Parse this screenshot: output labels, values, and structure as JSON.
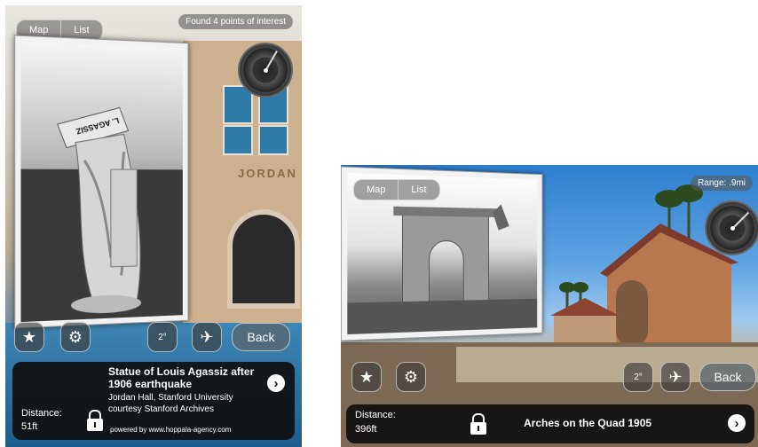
{
  "screen1": {
    "tabs": [
      "Map",
      "List"
    ],
    "status": "Found 4 points of interest",
    "building_label": "JORDAN",
    "photo_plaque": "L. AGASSIZ",
    "range_label": "2°",
    "back_label": "Back",
    "poi_title": "Statue of Louis Agassiz after 1906 earthquake",
    "poi_lines": [
      "Jordan Hall, Stanford University",
      "courtesy Stanford Archives"
    ],
    "distance_label": "Distance:",
    "distance_value": "51ft",
    "footer": "powered by www.hoppala-agency.com"
  },
  "screen2": {
    "tabs": [
      "Map",
      "List"
    ],
    "range": "Range: .9mi",
    "range_label": "2°",
    "back_label": "Back",
    "distance_label": "Distance:",
    "distance_value": "396ft",
    "poi_title": "Arches on the Quad 1905"
  },
  "icons": {
    "star": "★",
    "gear": "⚙",
    "bird": "✈",
    "chevron": "›"
  },
  "colors": {
    "panel": "#0f0f0f",
    "accent": "#ffffff"
  }
}
